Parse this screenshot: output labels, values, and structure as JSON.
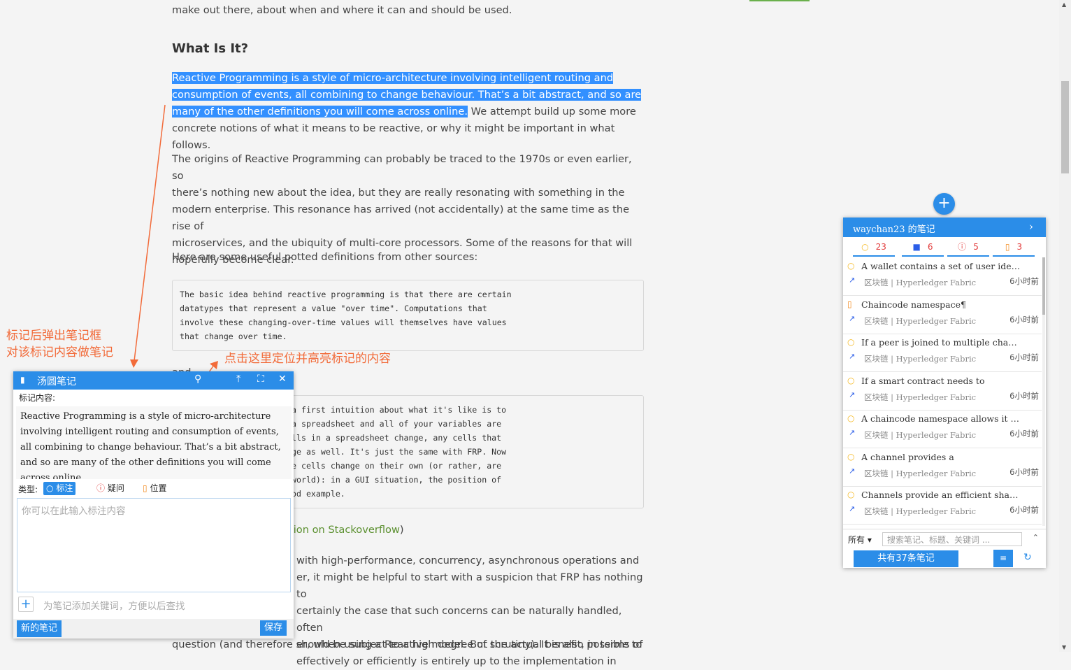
{
  "article": {
    "intro_tail": "make out there, about when and where it can and should be used.",
    "heading": "What Is It?",
    "p1_highlight_l1": "Reactive Programming is a style of micro-architecture involving intelligent routing and",
    "p1_highlight_l2": "consumption of events, all combining to change behaviour. That’s a bit abstract, and so are",
    "p1_highlight_l3": "many of the other definitions you will come across online.",
    "p1_rest_l3": " We attempt build up some more",
    "p1_l4": "concrete notions of what it means to be reactive, or why it might be important in what follows.",
    "p2_l1": "The origins of Reactive Programming can probably be traced to the 1970s or even earlier, so",
    "p2_l2": "there’s nothing new about the idea, but they are really resonating with something in the",
    "p2_l3": "modern enterprise. This resonance has arrived (not accidentally) at the same time as the rise of",
    "p2_l4": "microservices, and the ubiquity of multi-core processors. Some of the reasons for that will",
    "p2_l5": "hopefully become clear.",
    "p3": "Here are some useful potted definitions from other sources:",
    "code1": "The basic idea behind reactive programming is that there are certain\ndatatypes that represent a value \"over time\". Computations that\ninvolve these changing-over-time values will themselves have values\nthat change over time.",
    "and": "and",
    "code2": "a first intuition about what it's like is to\na spreadsheet and all of your variables are\nlls in a spreadsheet change, any cells that\nge as well. It's just the same with FRP. Now\ne cells change on their own (or rather, are\nworld): in a GUI situation, the position of\nod example.",
    "link": "tion on Stackoverflow",
    "link_close": ")",
    "p4_l1": "with high-performance, concurrency, asynchronous operations and",
    "p4_l2": "er, it might be helpful to start with a suspicion that FRP has nothing to",
    "p4_l3": "certainly the case that such concerns can be naturally handled, often",
    "p4_l4": "er, when using a Reactive model. But the actual benefit, in terms of",
    "p4_l5": "effectively or efficiently is entirely up to the implementation in",
    "p4_l6": "question (and therefore should be subject to a high degree of scrutiny). It is also possible to"
  },
  "annotations": {
    "left_l1": "标记后弹出笔记框",
    "left_l2": "对该标记内容做笔记",
    "mid": "点击这里定位并高亮标记的内容",
    "color": "#f26b3a"
  },
  "popup": {
    "title": "汤圆笔记",
    "mark_label": "标记内容:",
    "mark_text": "Reactive Programming is a style of micro-architecture involving intelligent routing and consumption of events, all combining to change behaviour. That’s a bit abstract, and so are many of the other definitions you will come across online.",
    "type_label": "类型:",
    "types": [
      "标注",
      "疑问",
      "位置"
    ],
    "note_placeholder": "你可以在此输入标注内容",
    "keyword_placeholder": "为笔记添加关键词，方便以后查找",
    "new_note": "新的笔记",
    "save": "保存",
    "icons": [
      "bookmark-icon",
      "location-pin-icon",
      "pin-top-icon",
      "expand-icon",
      "close-icon"
    ]
  },
  "panel": {
    "title": "waychan23 的笔记",
    "stats": [
      {
        "icon": "bulb-icon",
        "count": "23"
      },
      {
        "icon": "video-icon",
        "count": "6"
      },
      {
        "icon": "question-icon",
        "count": "5"
      },
      {
        "icon": "clipboard-icon",
        "count": "3"
      }
    ],
    "items": [
      {
        "type": "bulb",
        "title": "A wallet contains a set of user identitie…",
        "category": "区块链 | Hyperledger Fabric",
        "time": "6小时前"
      },
      {
        "type": "clipboard",
        "title": "Chaincode namespace¶",
        "category": "区块链 | Hyperledger Fabric",
        "time": "6小时前"
      },
      {
        "type": "bulb",
        "title": "If a peer is joined to multiple channels, …",
        "category": "区块链 | Hyperledger Fabric",
        "time": "6小时前"
      },
      {
        "type": "bulb",
        "title": "If a smart contract needs to",
        "category": "区块链 | Hyperledger Fabric",
        "time": "6小时前"
      },
      {
        "type": "bulb",
        "title": "A chaincode namespace allows it to ke…",
        "category": "区块链 | Hyperledger Fabric",
        "time": "6小时前"
      },
      {
        "type": "bulb",
        "title": "A channel provides a",
        "category": "区块链 | Hyperledger Fabric",
        "time": "6小时前"
      },
      {
        "type": "bulb",
        "title": "Channels provide an efficient sharing o…",
        "category": "区块链 | Hyperledger Fabric",
        "time": "6小时前"
      }
    ],
    "filter_all": "所有",
    "search_placeholder": "搜索笔记、标题、关键词 ...",
    "count_label": "共有37条笔记"
  },
  "colors": {
    "accent": "#2b8de8",
    "highlight": "#3390ff",
    "stat_count": "#e23c3c"
  }
}
